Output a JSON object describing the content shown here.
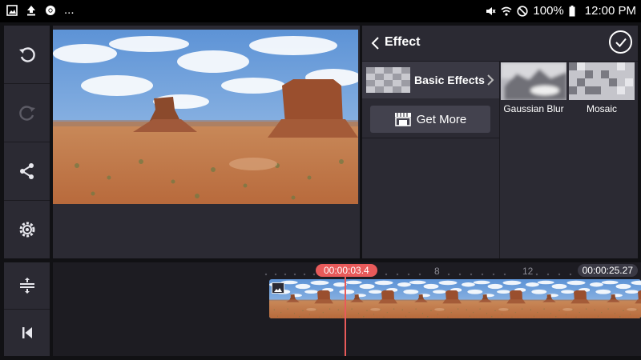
{
  "status_bar": {
    "battery": "100%",
    "time": "12:00 PM",
    "notification_more": "...",
    "icons": [
      "image-icon",
      "upload-icon",
      "chrome-icon",
      "mute-icon",
      "wifi-icon",
      "do-not-disturb-icon",
      "battery-icon"
    ]
  },
  "toolbar": {
    "buttons": [
      "undo-icon",
      "redo-icon",
      "share-icon",
      "settings-icon"
    ]
  },
  "effect_panel": {
    "title": "Effect",
    "category": "Basic Effects",
    "get_more": "Get More",
    "effects": [
      "Gaussian Blur",
      "Mosaic"
    ]
  },
  "timeline": {
    "current_time": "00:00:03.4",
    "end_time": "00:00:25.27",
    "tick_labels": [
      "8",
      "12"
    ],
    "bottom_buttons": [
      "split-adjust-icon",
      "skip-to-start-icon"
    ]
  },
  "colors": {
    "accent": "#e85a5a",
    "panel": "#2b2a33",
    "background": "#111114"
  }
}
